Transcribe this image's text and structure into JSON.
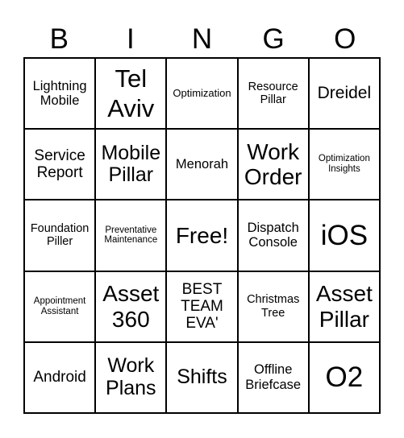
{
  "header": {
    "letters": [
      "B",
      "I",
      "N",
      "G",
      "O"
    ]
  },
  "board": {
    "rows": [
      [
        "Lightning Mobile",
        "Tel Aviv",
        "Optimization",
        "Resource Pillar",
        "Dreidel"
      ],
      [
        "Service Report",
        "Mobile Pillar",
        "Menorah",
        "Work Order",
        "Optimization Insights"
      ],
      [
        "Foundation Piller",
        "Preventative Maintenance",
        "Free!",
        "Dispatch Console",
        "iOS"
      ],
      [
        "Appointment Assistant",
        "Asset 360",
        "BEST TEAM EVA'",
        "Christmas Tree",
        "Asset Pillar"
      ],
      [
        "Android",
        "Work Plans",
        "Shifts",
        "Offline Briefcase",
        "O2"
      ]
    ]
  },
  "colors": {
    "background": "#ffffff",
    "grid_lines": "#000000",
    "text": "#000000"
  }
}
